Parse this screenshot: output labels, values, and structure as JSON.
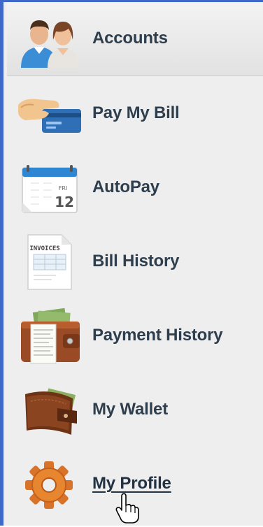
{
  "menu": {
    "accent_color": "#3e69c8",
    "items": [
      {
        "label": "Accounts",
        "icon": "users-icon"
      },
      {
        "label": "Pay My Bill",
        "icon": "credit-card-icon"
      },
      {
        "label": "AutoPay",
        "icon": "calendar-icon"
      },
      {
        "label": "Bill History",
        "icon": "invoice-icon"
      },
      {
        "label": "Payment History",
        "icon": "receipt-wallet-icon"
      },
      {
        "label": "My Wallet",
        "icon": "wallet-icon"
      },
      {
        "label": "My Profile",
        "icon": "gear-icon"
      }
    ],
    "active_item": "Accounts",
    "hovered_item": "My Profile",
    "calendar": {
      "day_abbr": "FRI",
      "day_number": "12"
    },
    "invoice": {
      "heading": "INVOICES"
    }
  }
}
